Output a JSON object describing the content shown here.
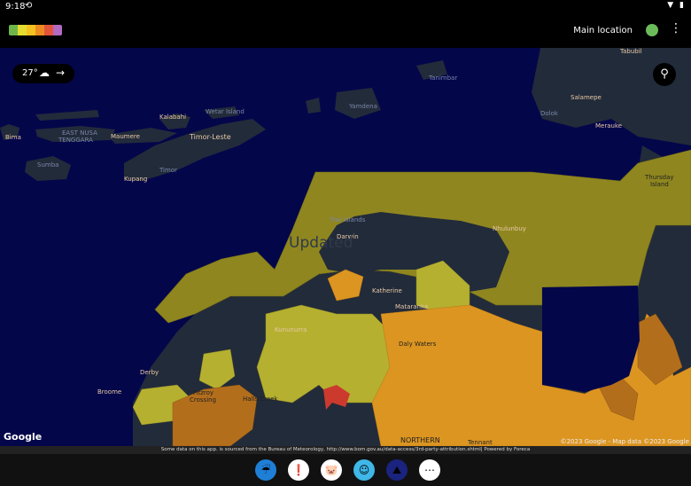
{
  "status_bar": {
    "time": "9:18",
    "sync_icon": "sync-icon",
    "right_icons": "wifi-icon battery-icon"
  },
  "app_bar": {
    "legend_colors": [
      "#6fb64a",
      "#e5dc2f",
      "#f4c21f",
      "#ee8a22",
      "#e3553a",
      "#b26ac2"
    ],
    "location_label": "Main location",
    "location_status_color": "#6cbb5a",
    "menu_icon": "⋮"
  },
  "map": {
    "weather_chip": {
      "temperature": "27°",
      "condition_icon": "cloud-rain-icon",
      "arrow": "→"
    },
    "search_icon": "⚲",
    "overlay_text": "Updated",
    "place_labels": {
      "bima": "Bima",
      "east_nusa": "EAST NUSA",
      "tenggara": "TENGGARA",
      "maumere": "Maumere",
      "kalabahi": "Kalabahi",
      "wetar": "Wetar Island",
      "timor_leste": "Timor-Leste",
      "timor": "Timor",
      "kupang": "Kupang",
      "sumba": "Sumba",
      "yamdena": "Yamdena",
      "tanimbar": "Tanimbar",
      "tabubil": "Tabubil",
      "salamepe": "Salamepe",
      "dolok": "Dolok",
      "merauke": "Merauke",
      "thursday": "Thursday",
      "island": "Island",
      "darwin": "Darwin",
      "tiwi": "Tiwi Islands",
      "nhulunbuy": "Nhulunbuy",
      "katherine": "Katherine",
      "mataranka": "Mataranka",
      "kununurra": "Kununurra",
      "derby": "Derby",
      "broome": "Broome",
      "fitzroy": "Fitzroy",
      "crossing": "Crossing",
      "halls_creek": "Halls Creek",
      "daly_waters": "Daly Waters",
      "northern": "NORTHERN",
      "tennant": "Tennant"
    },
    "google_label": "Google",
    "copyright": "©2023 Google - Map data ©2023 Google"
  },
  "attribution": "Some data on this app. is sourced from the Bureau of Meteorology, http://www.bom.gov.au/data-access/3rd-party-attribution.shtml| Powered by Foreca",
  "nav_apps": [
    {
      "name": "rain-radar-app",
      "glyph": "☔",
      "bg": "#1f7fd6"
    },
    {
      "name": "weather-alert-app",
      "glyph": "❗",
      "bg": "#ffffff"
    },
    {
      "name": "pig-app",
      "glyph": "🐷",
      "bg": "#ffffff"
    },
    {
      "name": "assistant-app",
      "glyph": "☺",
      "bg": "#3fb7e8"
    },
    {
      "name": "triangle-app",
      "glyph": "⛰",
      "bg": "#1a237e"
    },
    {
      "name": "app-drawer",
      "glyph": "⋯",
      "bg": "#ffffff"
    }
  ]
}
